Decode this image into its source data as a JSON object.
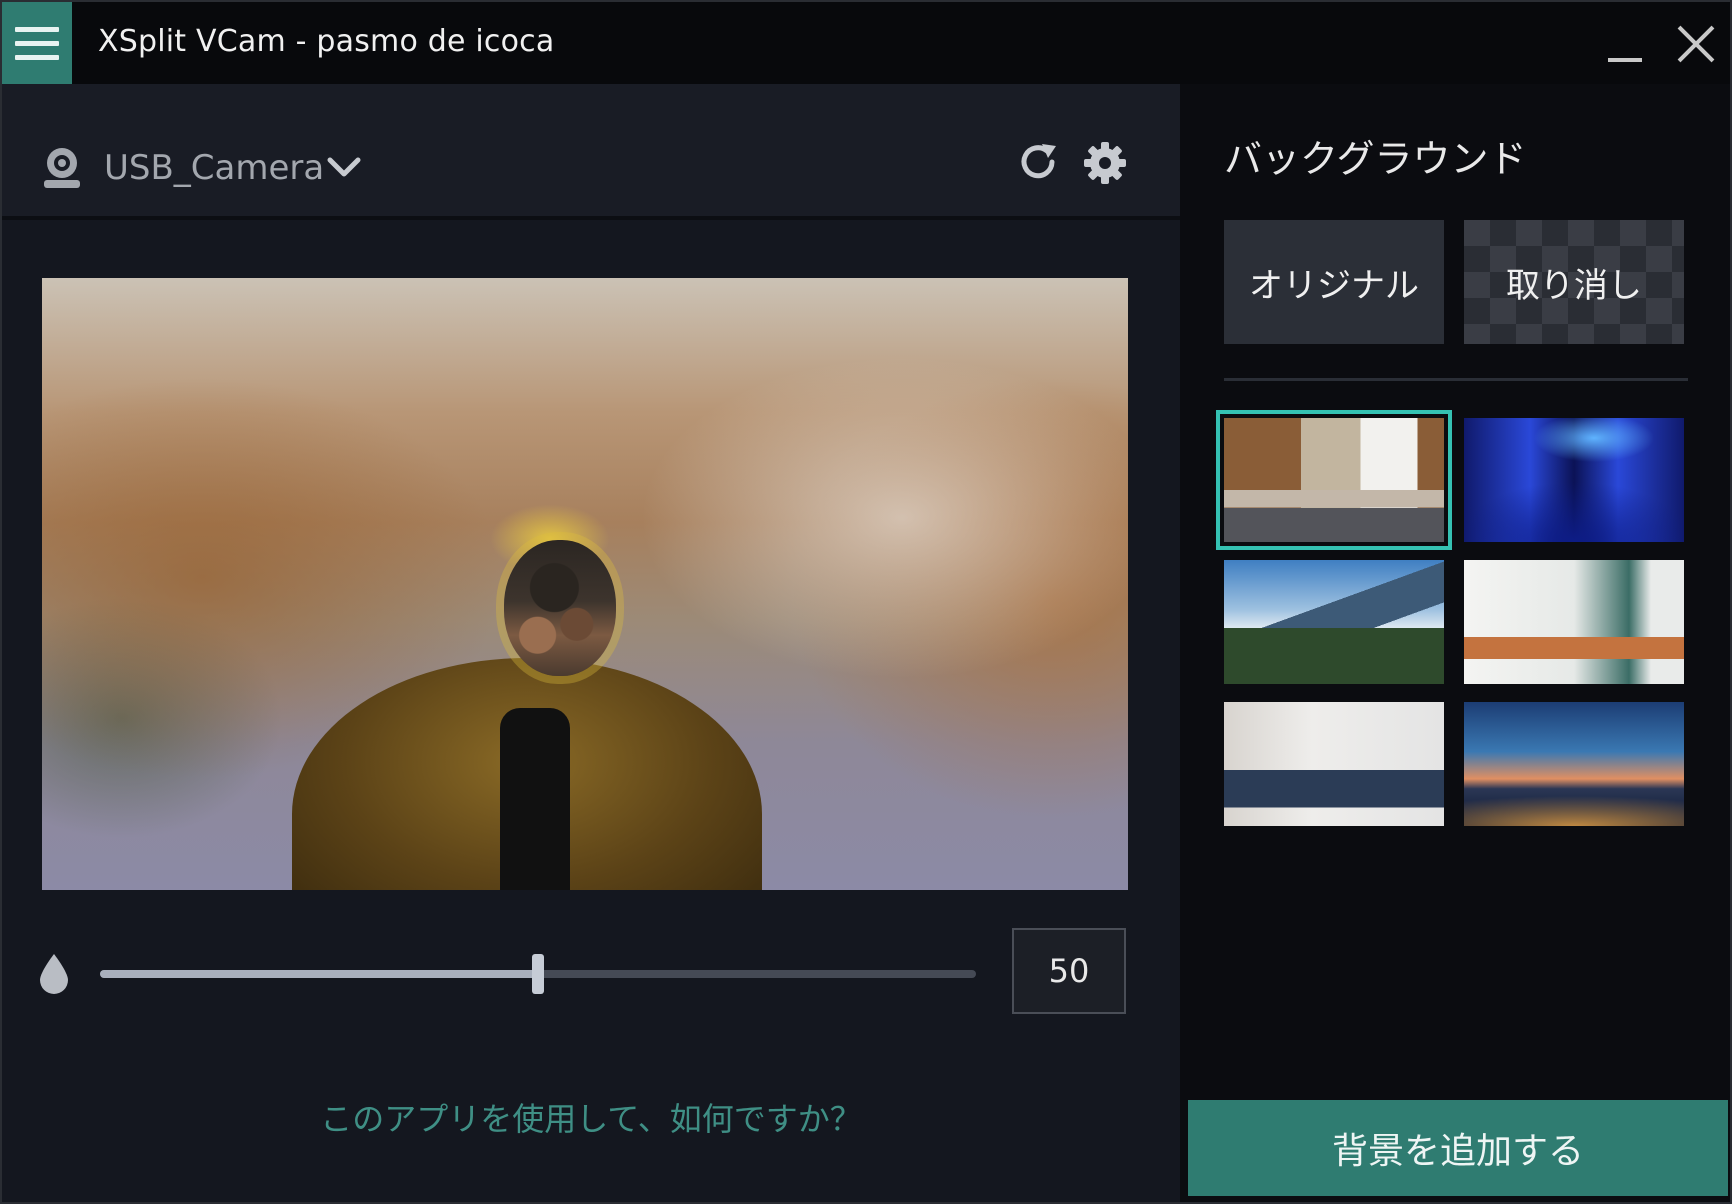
{
  "window": {
    "title": "XSplit VCam - pasmo de icoca"
  },
  "camera": {
    "name": "USB_Camera"
  },
  "blur": {
    "value": 50,
    "value_label": "50",
    "fraction": 0.5
  },
  "feedback": {
    "label": "このアプリを使用して、如何ですか？"
  },
  "background_panel": {
    "title": "バックグラウンド",
    "original_label": "オリジナル",
    "cancel_label": "取り消し",
    "add_label": "背景を追加する",
    "thumbnails": [
      "conference-room",
      "blue-neon-lounge",
      "mountain-landscape",
      "bright-living-room",
      "sofa-with-guitar",
      "city-bridge-night"
    ],
    "selected_thumbnail": "conference-room"
  },
  "colors": {
    "accent": "#2f7c71",
    "selection": "#35c2b3",
    "link": "#3f8f85"
  }
}
